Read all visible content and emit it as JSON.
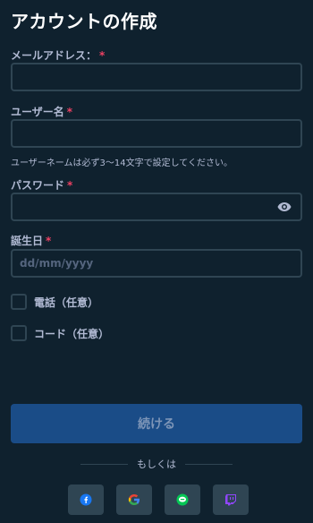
{
  "page": {
    "title": "アカウントの作成"
  },
  "form": {
    "email": {
      "label": "メールアドレス：",
      "required_mark": "*",
      "value": "",
      "placeholder": ""
    },
    "username": {
      "label": "ユーザー名",
      "required_mark": "*",
      "value": "",
      "placeholder": "",
      "hint": "ユーザーネームは必ず3〜14文字で設定してください。"
    },
    "password": {
      "label": "パスワード",
      "required_mark": "*",
      "value": "",
      "placeholder": ""
    },
    "birthday": {
      "label": "誕生日",
      "required_mark": "*",
      "value": "",
      "placeholder": "dd/mm/yyyy"
    },
    "options": [
      {
        "label": "電話（任意）",
        "checked": false
      },
      {
        "label": "コード（任意）",
        "checked": false
      }
    ],
    "continue_label": "続ける",
    "divider_text": "もしくは"
  },
  "social": [
    {
      "icon": "facebook-icon",
      "color": "#1877f2"
    },
    {
      "icon": "google-icon",
      "color": "#4285f4"
    },
    {
      "icon": "line-icon",
      "color": "#06c755"
    },
    {
      "icon": "twitch-icon",
      "color": "#9146ff"
    }
  ],
  "colors": {
    "background": "#0f212e",
    "input_border": "#2f4553",
    "required": "#ed4163",
    "primary_button": "#1a4c87"
  }
}
